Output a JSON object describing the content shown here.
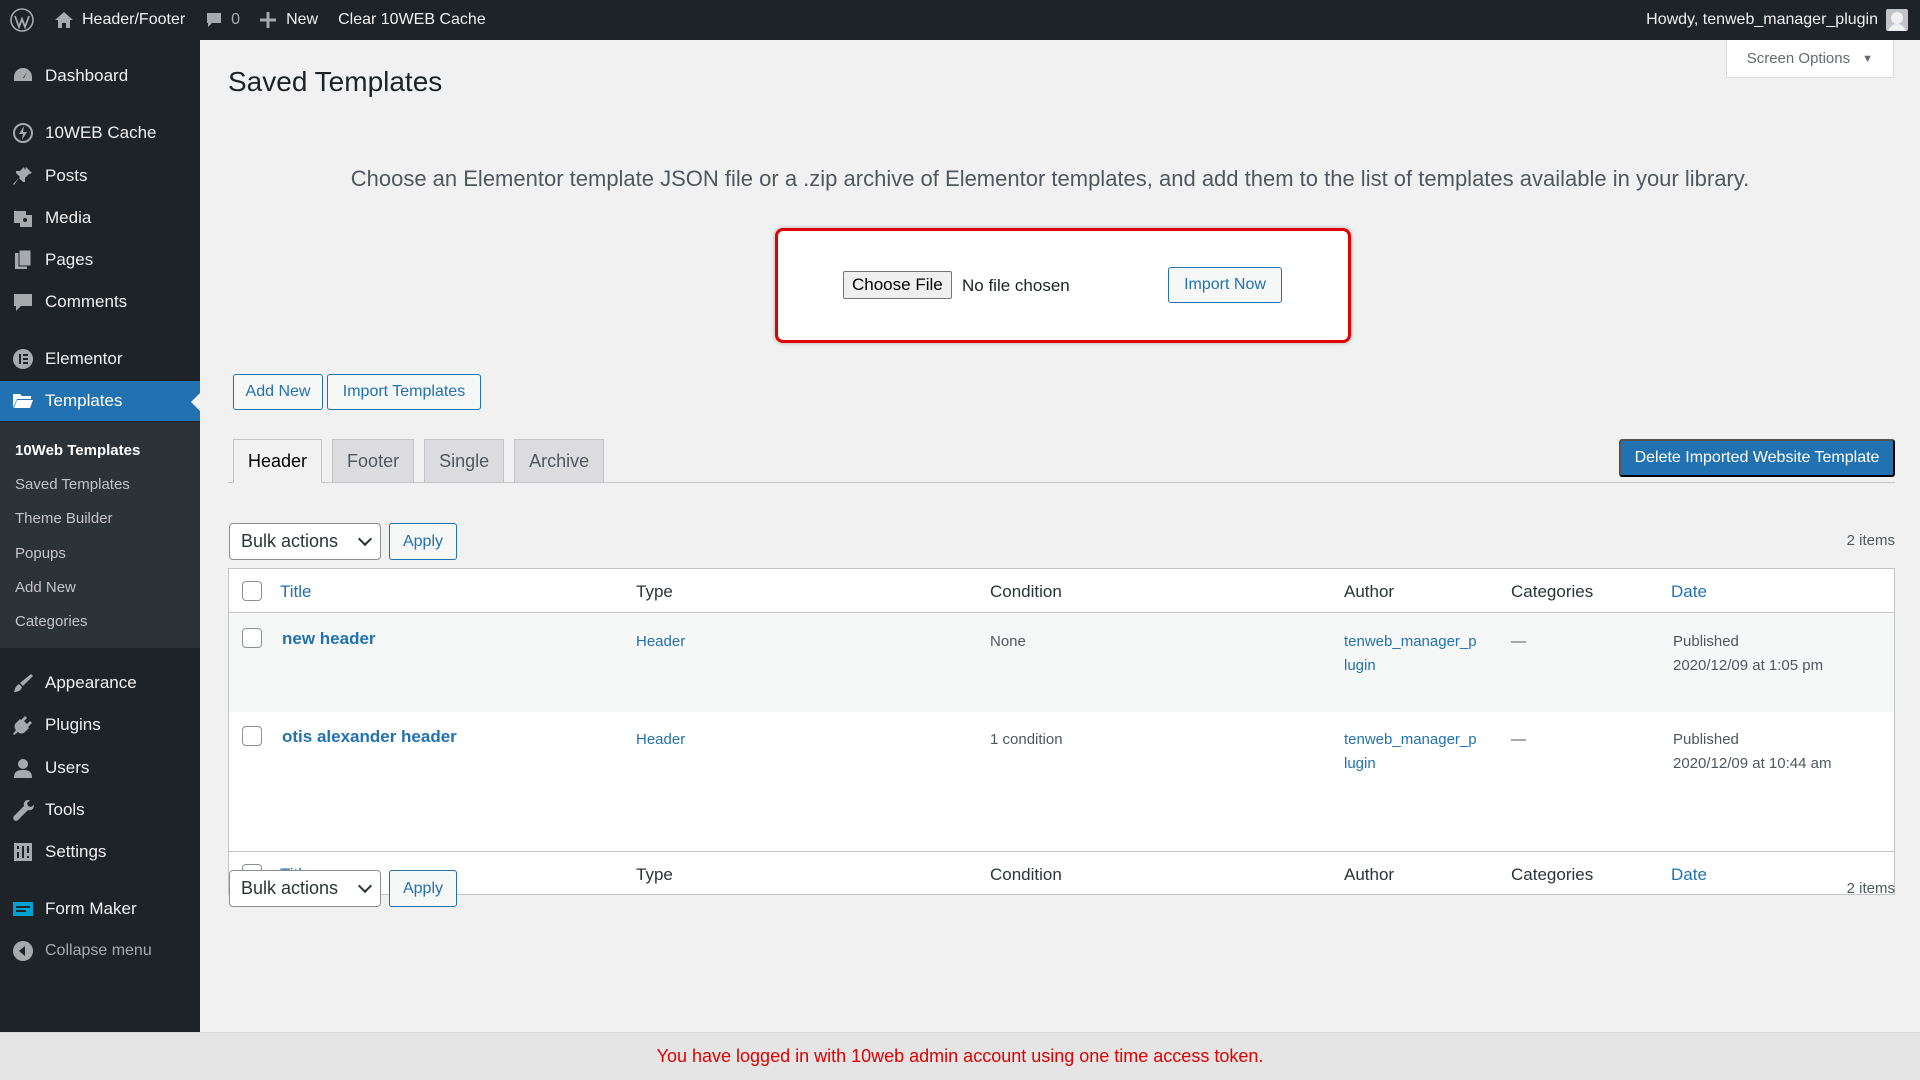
{
  "adminbar": {
    "site_name": "Header/Footer",
    "comments_count": "0",
    "new_label": "New",
    "clear_cache_label": "Clear 10WEB Cache",
    "howdy": "Howdy, tenweb_manager_plugin"
  },
  "sidebar": {
    "items": [
      {
        "label": "Dashboard",
        "icon": "dashboard-icon"
      },
      {
        "label": "10WEB Cache",
        "icon": "cache-icon"
      },
      {
        "label": "Posts",
        "icon": "pin-icon"
      },
      {
        "label": "Media",
        "icon": "media-icon"
      },
      {
        "label": "Pages",
        "icon": "pages-icon"
      },
      {
        "label": "Comments",
        "icon": "comments-icon"
      },
      {
        "label": "Elementor",
        "icon": "elementor-icon"
      },
      {
        "label": "Templates",
        "icon": "folder-icon"
      },
      {
        "label": "Appearance",
        "icon": "appearance-icon"
      },
      {
        "label": "Plugins",
        "icon": "plugins-icon"
      },
      {
        "label": "Users",
        "icon": "users-icon"
      },
      {
        "label": "Tools",
        "icon": "tools-icon"
      },
      {
        "label": "Settings",
        "icon": "settings-icon"
      },
      {
        "label": "Form Maker",
        "icon": "form-maker-icon"
      },
      {
        "label": "Collapse menu",
        "icon": "collapse-icon"
      }
    ],
    "submenu": [
      "10Web Templates",
      "Saved Templates",
      "Theme Builder",
      "Popups",
      "Add New",
      "Categories"
    ]
  },
  "page": {
    "title": "Saved Templates",
    "screen_options": "Screen Options",
    "import_description": "Choose an Elementor template JSON file or a .zip archive of Elementor templates, and add them to the list of templates available in your library.",
    "choose_file": "Choose File",
    "no_file": "No file chosen",
    "import_now": "Import Now",
    "add_new": "Add New",
    "import_templates": "Import Templates",
    "tabs": [
      "Header",
      "Footer",
      "Single",
      "Archive"
    ],
    "delete_button": "Delete Imported Website Template",
    "bulk_actions": "Bulk actions",
    "apply": "Apply",
    "items_count": "2 items"
  },
  "table": {
    "columns": [
      "Title",
      "Type",
      "Condition",
      "Author",
      "Categories",
      "Date"
    ],
    "rows": [
      {
        "title": "new header",
        "type": "Header",
        "condition": "None",
        "author_line1": "tenweb_manager_p",
        "author_line2": "lugin",
        "categories": "—",
        "status": "Published",
        "date": "2020/12/09 at 1:05 pm"
      },
      {
        "title": "otis alexander header",
        "type": "Header",
        "condition": "1 condition",
        "author_line1": "tenweb_manager_p",
        "author_line2": "lugin",
        "categories": "—",
        "status": "Published",
        "date": "2020/12/09 at 10:44 am"
      }
    ]
  },
  "notice": "You have logged in with 10web admin account using one time access token.",
  "colors": {
    "accent": "#2271b1",
    "sidebar": "#1d2327",
    "highlight": "#e00000"
  }
}
